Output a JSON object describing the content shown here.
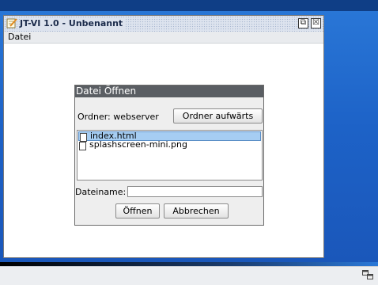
{
  "window": {
    "title": "JT-VI 1.0 - Unbenannt",
    "icon": "notepad-pencil-icon",
    "buttons": [
      {
        "name": "restore-button",
        "glyph": "⧉"
      },
      {
        "name": "close-button",
        "glyph": "☒"
      }
    ]
  },
  "menubar": {
    "items": [
      {
        "label": "Datei"
      }
    ]
  },
  "dialog": {
    "title": "Datei Öffnen",
    "folder_label": "Ordner: webserver",
    "folder_up_label": "Ordner aufwärts",
    "files": [
      {
        "name": "index.html",
        "selected": true
      },
      {
        "name": "splashscreen-mini.png",
        "selected": false
      }
    ],
    "filename_label": "Dateiname:",
    "filename_value": "",
    "open_label": "Öffnen",
    "cancel_label": "Abbrechen"
  },
  "taskbar": {
    "tray_icon": "windows-switch-icon"
  },
  "colors": {
    "desktop": "#1f5fbf",
    "dialog_titlebar": "#5a5e63",
    "selection": "#a6cdf2"
  }
}
